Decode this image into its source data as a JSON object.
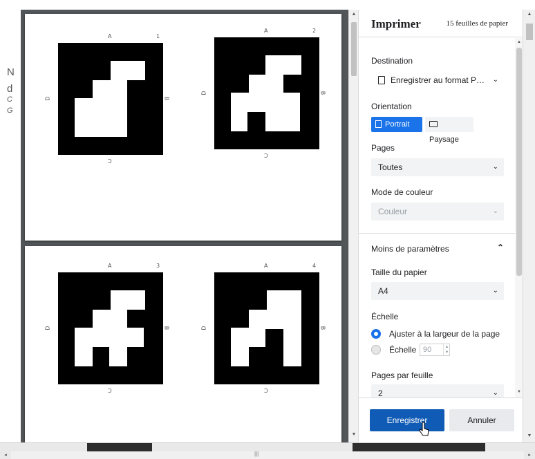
{
  "background_doc": {
    "fragments": [
      "N",
      "d",
      "C",
      "G"
    ]
  },
  "preview": {
    "pages": [
      {
        "markers": [
          {
            "id": "1",
            "top": "A",
            "left": "D",
            "right": "B",
            "bottom": "C"
          },
          {
            "id": "2",
            "top": "A",
            "left": "D",
            "right": "B",
            "bottom": "C"
          }
        ]
      },
      {
        "markers": [
          {
            "id": "3",
            "top": "A",
            "left": "D",
            "right": "B",
            "bottom": "C"
          },
          {
            "id": "4",
            "top": "A",
            "left": "D",
            "right": "B",
            "bottom": "C"
          }
        ]
      }
    ]
  },
  "dialog": {
    "title": "Imprimer",
    "sheet_count": "15 feuilles de papier",
    "destination": {
      "label": "Destination",
      "value": "Enregistrer au format P…"
    },
    "orientation": {
      "label": "Orientation",
      "portrait": "Portrait",
      "landscape": "Paysage",
      "selected": "portrait"
    },
    "pages": {
      "label": "Pages",
      "value": "Toutes"
    },
    "color_mode": {
      "label": "Mode de couleur",
      "value": "Couleur",
      "disabled": true
    },
    "toggle_settings": "Moins de paramètres",
    "paper_size": {
      "label": "Taille du papier",
      "value": "A4"
    },
    "scale": {
      "label": "Échelle",
      "fit_width": "Ajuster à la largeur de la page",
      "custom": "Échelle",
      "custom_value": "90",
      "selected": "fit_width"
    },
    "pages_per_sheet": {
      "label": "Pages par feuille",
      "value": "2"
    },
    "save_button": "Enregistrer",
    "cancel_button": "Annuler"
  },
  "colors": {
    "accent": "#1a73e8",
    "save_button": "#0f5bb5",
    "preview_background": "#525659"
  },
  "icons": {
    "destination": "document-icon",
    "portrait": "portrait-page-icon",
    "landscape": "landscape-page-icon",
    "dropdown": "chevron-down-icon",
    "collapse": "chevron-up-icon"
  }
}
